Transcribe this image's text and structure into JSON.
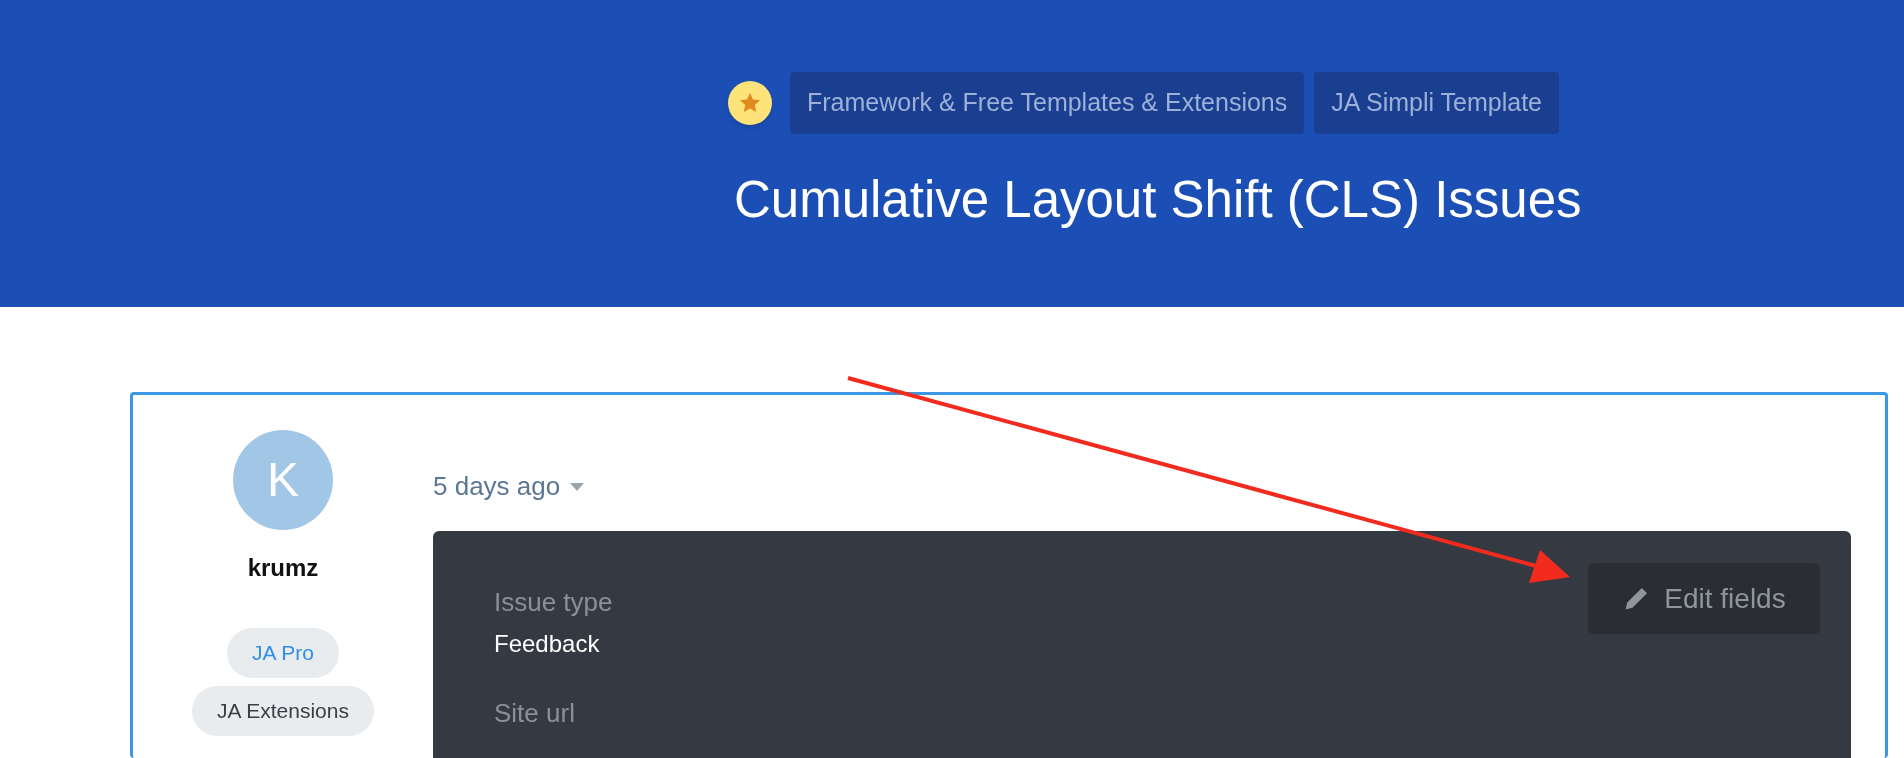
{
  "header": {
    "breadcrumbs": [
      {
        "label": "Framework & Free Templates & Extensions"
      },
      {
        "label": "JA Simpli Template"
      }
    ],
    "title": "Cumulative Layout Shift (CLS) Issues"
  },
  "post": {
    "author": {
      "initial": "K",
      "name": "krumz",
      "badges": [
        {
          "label": "JA Pro",
          "kind": "highlight"
        },
        {
          "label": "JA Extensions",
          "kind": "plain"
        }
      ]
    },
    "time": "5 days ago",
    "edit_button": "Edit fields",
    "fields": [
      {
        "label": "Issue type",
        "value": "Feedback"
      },
      {
        "label": "Site url"
      }
    ]
  }
}
